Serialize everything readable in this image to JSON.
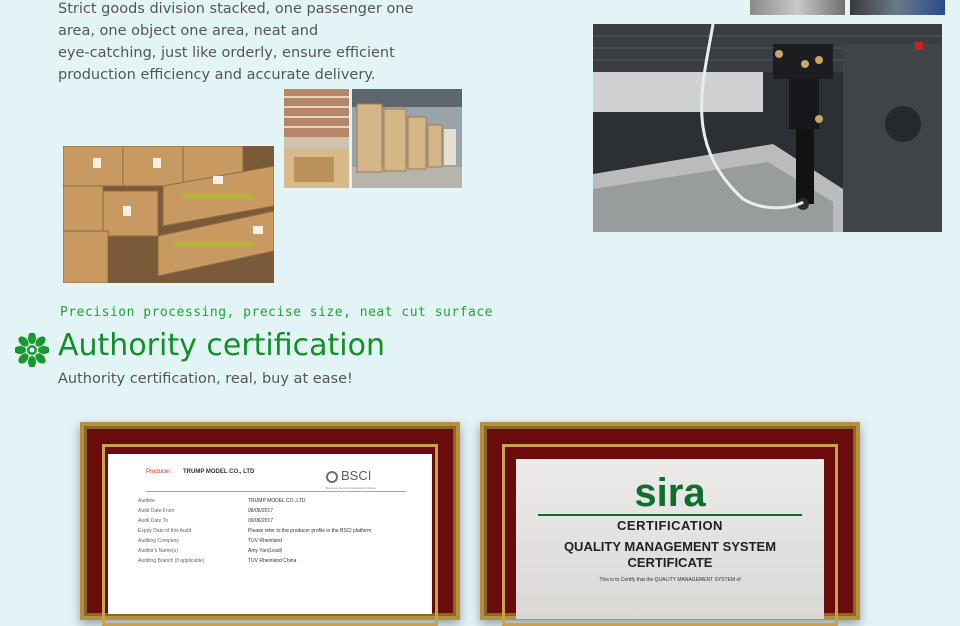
{
  "intro": {
    "line1": "Strict goods division stacked, one passenger one",
    "line2": "area, one object one area, neat and",
    "line3": "eye-catching, just like orderly, ensure efficient",
    "line4": "production efficiency and accurate delivery."
  },
  "precision_caption": "Precision processing, precise size, neat cut surface",
  "authority": {
    "title": "Authority certification",
    "subtitle": "Authority certification, real, buy at ease!"
  },
  "bsci_doc": {
    "producer_label": "Producer :",
    "producer_name": "TRUMP MODEL CO., LTD",
    "logo_text": "BSCI",
    "logo_tagline": "Business Social Compliance Initiative",
    "rows": [
      {
        "label": "Auditee",
        "value": "TRUMP MODEL CO.,LTD"
      },
      {
        "label": "Audit Date From",
        "value": "08/06/2017"
      },
      {
        "label": "Audit Date To",
        "value": "09/06/2017"
      },
      {
        "label": "Expiry Date of this Audit",
        "value": "Please refer to the producer profile in the BSCI platform"
      },
      {
        "label": "Auditing Company",
        "value": "TUV Rheinland"
      },
      {
        "label": "Auditor's Name(s)",
        "value": "Amy Yan(Lead)"
      },
      {
        "label": "Auditing Branch (if applicable)",
        "value": "TUV Rheinland China"
      }
    ]
  },
  "sira_cert": {
    "logo": "sira",
    "cert_word": "CERTIFICATION",
    "heading1": "QUALITY MANAGEMENT SYSTEM",
    "heading2": "CERTIFICATE",
    "statement": "This is to Certify that the QUALITY MANAGEMENT SYSTEM of"
  },
  "colors": {
    "background": "#e3f4f7",
    "accent_green": "#119025",
    "frame": "#6b0c0c",
    "gold": "#b6913d"
  },
  "icons": {
    "section_icon": "green-flower-icon"
  }
}
